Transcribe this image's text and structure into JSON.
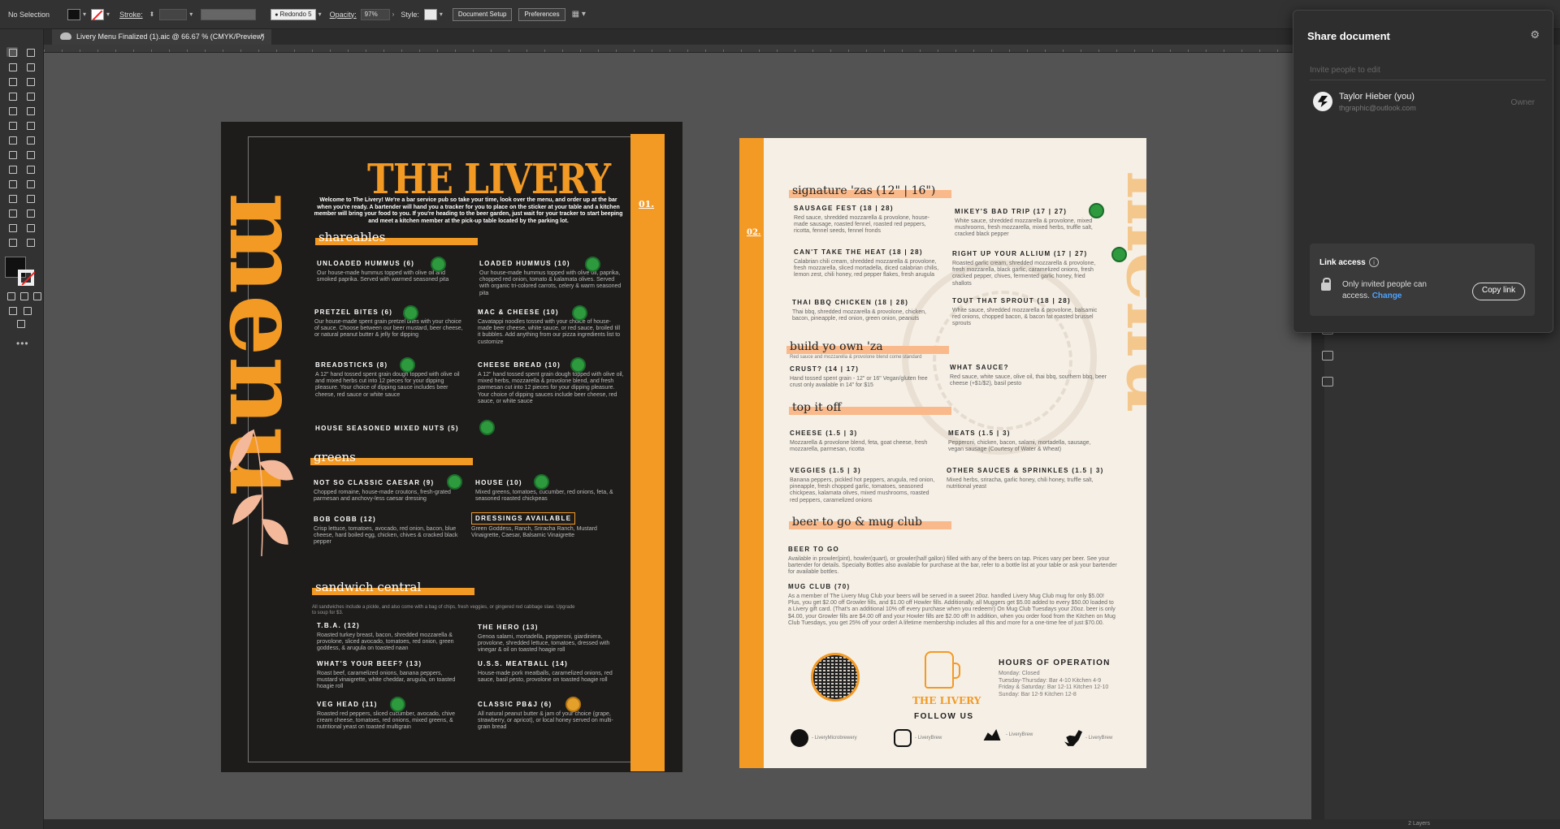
{
  "control_bar": {
    "selection": "No Selection",
    "stroke_label": "Stroke:",
    "brush": "Redondo 5",
    "opacity_label": "Opacity:",
    "opacity_value": "97%",
    "style_label": "Style:",
    "document_setup": "Document Setup",
    "preferences": "Preferences"
  },
  "tab": {
    "title": "Livery Menu Finalized (1).aic @ 66.67 % (CMYK/Preview)",
    "close": "×"
  },
  "status_bar": {
    "layers": "2 Layers"
  },
  "share": {
    "title": "Share document",
    "invite_placeholder": "Invite people to edit",
    "user_name": "Taylor Hieber (you)",
    "user_email": "thgraphic@outlook.com",
    "role": "Owner",
    "link_access_label": "Link access",
    "access_text": "Only invited people can access.",
    "change": "Change",
    "copy_link": "Copy link"
  },
  "page1": {
    "menu_word": "menu",
    "title": "THE LIVERY",
    "page_number": "01.",
    "welcome": "Welcome to The Livery! We're a bar service pub so take your time, look over the menu, and order up at the bar when you're ready. A bartender will hand you a tracker for you to place on the sticker at your table and a kitchen member will bring your food to you. If you're heading to the beer garden, just wait for your tracker to start beeping and meet a kitchen member at the pick-up table located by the parking lot.",
    "shareables": {
      "heading": "shareables",
      "items": [
        {
          "name": "UNLOADED HUMMUS (6)",
          "desc": "Our house-made hummus topped with olive oil and smoked paprika. Served with warmed seasoned pita"
        },
        {
          "name": "LOADED HUMMUS (10)",
          "desc": "Our house-made hummus topped with olive oil, paprika, chopped red onion, tomato & kalamata olives. Served with organic tri-colored carrots, celery & warm seasoned pita"
        },
        {
          "name": "PRETZEL BITES (6)",
          "desc": "Our house-made spent grain pretzel bites with your choice of sauce. Choose between our beer mustard, beer cheese, or natural peanut butter & jelly for dipping"
        },
        {
          "name": "MAC & CHEESE (10)",
          "desc": "Cavatappi noodles tossed with your choice of house-made beer cheese, white sauce, or red sauce, broiled till it bubbles. Add anything from our pizza ingredients list to customize"
        },
        {
          "name": "BREADSTICKS (8)",
          "desc": "A 12\" hand tossed spent grain dough topped with olive oil and mixed herbs cut into 12 pieces for your dipping pleasure. Your choice of dipping sauce includes beer cheese, red sauce or white sauce"
        },
        {
          "name": "CHEESE BREAD (10)",
          "desc": "A 12\" hand tossed spent grain dough topped with olive oil, mixed herbs, mozzarella & provolone blend, and fresh parmesan cut into 12 pieces for your dipping pleasure. Your choice of dipping sauces include beer cheese, red sauce, or white sauce"
        },
        {
          "name": "HOUSE SEASONED MIXED NUTS (5)",
          "desc": ""
        }
      ]
    },
    "greens": {
      "heading": "greens",
      "items": [
        {
          "name": "NOT SO CLASSIC CAESAR (9)",
          "desc": "Chopped romaine, house-made croutons, fresh-grated parmesan and anchovy-less caesar dressing"
        },
        {
          "name": "HOUSE (10)",
          "desc": "Mixed greens, tomatoes, cucumber, red onions, feta, & seasoned roasted chickpeas"
        },
        {
          "name": "BOB COBB (12)",
          "desc": "Crisp lettuce, tomatoes, avocado, red onion, bacon, blue cheese, hard boiled egg, chicken, chives & cracked black pepper"
        },
        {
          "name": "DRESSINGS AVAILABLE",
          "desc": "Green Goddess, Ranch, Sriracha Ranch, Mustard Vinaigrette, Caesar, Balsamic Vinaigrette"
        }
      ]
    },
    "sandwich": {
      "heading": "sandwich central",
      "note": "All sandwiches include a pickle, and also come with a bag of chips, fresh veggies, or gingered red cabbage slaw. Upgrade to soup for $3.",
      "items": [
        {
          "name": "T.B.A. (12)",
          "desc": "Roasted turkey breast, bacon, shredded mozzarella & provolone, sliced avocado, tomatoes, red onion, green goddess, & arugula on toasted naan"
        },
        {
          "name": "THE HERO (13)",
          "desc": "Genoa salami, mortadella, pepperoni, giardiniera, provolone, shredded lettuce, tomatoes, dressed with vinegar & oil on toasted hoagie roll"
        },
        {
          "name": "WHAT'S YOUR BEEF? (13)",
          "desc": "Roast beef, caramelized onions, banana peppers, mustard vinaigrette, white cheddar, arugula, on toasted hoagie roll"
        },
        {
          "name": "U.S.S. MEATBALL (14)",
          "desc": "House-made pork meatballs, caramelized onions, red sauce, basil pesto, provolone on toasted hoagie roll"
        },
        {
          "name": "VEG HEAD (11)",
          "desc": "Roasted red peppers, sliced cucumber, avocado, chive cream cheese, tomatoes, red onions, mixed greens, & nutritional yeast on toasted multigrain"
        },
        {
          "name": "CLASSIC PB&J (6)",
          "desc": "All natural peanut butter & jam of your choice (grape, strawberry, or apricot), or local honey served on multi-grain bread"
        }
      ]
    }
  },
  "page2": {
    "page_number": "02.",
    "menu_word": "menu",
    "zas": {
      "heading": "signature 'zas (12\" | 16\")",
      "items": [
        {
          "name": "SAUSAGE FEST (18 | 28)",
          "desc": "Red sauce, shredded mozzarella & provolone, house-made sausage, roasted fennel, roasted red peppers, ricotta, fennel seeds, fennel fronds"
        },
        {
          "name": "MIKEY'S BAD TRIP (17 | 27)",
          "desc": "White sauce, shredded mozzarella & provolone, mixed mushrooms, fresh mozzarella, mixed herbs, truffle salt, cracked black pepper"
        },
        {
          "name": "CAN'T TAKE THE HEAT (18 | 28)",
          "desc": "Calabrian chili cream, shredded mozzarella & provolone, fresh mozzarella, sliced mortadella, diced calabrian chilis, lemon zest, chili honey, red pepper flakes, fresh arugula"
        },
        {
          "name": "RIGHT UP YOUR ALLIUM (17 | 27)",
          "desc": "Roasted garlic cream, shredded mozzarella & provolone, fresh mozzarella, black garlic, caramelized onions, fresh cracked pepper, chives, fermented garlic honey, fried shallots"
        },
        {
          "name": "THAI BBQ CHICKEN (18 | 28)",
          "desc": "Thai bbq, shredded mozzarella & provolone, chicken, bacon, pineapple, red onion, green onion, peanuts"
        },
        {
          "name": "TOUT THAT SPROUT (18 | 28)",
          "desc": "White sauce, shredded mozzarella & provolone, balsamic red onions, chopped bacon, & bacon fat roasted brussel sprouts"
        }
      ]
    },
    "byo": {
      "heading": "build yo own 'za",
      "sub": "Red sauce and mozzarella & provolone blend come standard",
      "items": [
        {
          "name": "CRUST? (14 | 17)",
          "desc": "Hand tossed spent grain - 12\" or 16\" Vegan/gluten free crust only available in 14\" for $15"
        },
        {
          "name": "WHAT SAUCE?",
          "desc": "Red sauce, white sauce, olive oil, thai bbq, southern bbq, beer cheese (+$1/$2), basil pesto"
        }
      ]
    },
    "topit": {
      "heading": "top it off",
      "items": [
        {
          "name": "CHEESE (1.5 | 3)",
          "desc": "Mozzarella & provolone blend, feta, goat cheese, fresh mozzarella, parmesan, ricotta"
        },
        {
          "name": "MEATS (1.5 | 3)",
          "desc": "Pepperoni, chicken, bacon, salami, mortadella, sausage, vegan sausage (Courtesy of Water & Wheat)"
        },
        {
          "name": "VEGGIES (1.5 | 3)",
          "desc": "Banana peppers, pickled hot peppers, arugula, red onion, pineapple, fresh chopped garlic, tomatoes, seasoned chickpeas, kalamata olives, mixed mushrooms, roasted red peppers, caramelized onions"
        },
        {
          "name": "OTHER SAUCES & SPRINKLES (1.5 | 3)",
          "desc": "Mixed herbs, sriracha, garlic honey, chili honey, truffle salt, nutritional yeast"
        }
      ]
    },
    "beer": {
      "heading": "beer to go & mug club",
      "items": [
        {
          "name": "BEER TO GO",
          "desc": "Available in prowler(pint), howler(quart), or growler(half gallon) filled with any of the beers on tap. Prices vary per beer. See your bartender for details. Specialty Bottles also available for purchase at the bar, refer to a bottle list at your table or ask your bartender for available bottles."
        },
        {
          "name": "MUG CLUB (70)",
          "desc": "As a member of The Livery Mug Club your beers will be served in a sweet 20oz. handled Livery Mug Club mug for only $5.00! Plus, you get $2.00 off Growler fills, and $1.00 off Howler fills. Additionally, all Muggers get $5.00 added to every $50.00 loaded to a Livery gift card. (That's an additional 10% off every purchase when you redeem!) On Mug Club Tuesdays your 20oz. beer is only $4.00, your Growler fills are $4.00 off and your Howler fills are $2.00 off! In addition, when you order food from the Kitchen on Mug Club Tuesdays, you get 25% off your order! A lifetime membership includes all this and more for a one-time fee of just $70.00."
        }
      ]
    },
    "logo_text": "THE LIVERY",
    "follow": "FOLLOW US",
    "hours": {
      "title": "HOURS OF OPERATION",
      "lines": [
        "Monday: Closed",
        "Tuesday-Thursday: Bar 4-10 Kitchen 4-9",
        "Friday & Saturday: Bar 12-11 Kitchen 12-10",
        "Sunday: Bar 12-9 Kitchen 12-8"
      ]
    },
    "social": [
      {
        "icon": "facebook-icon",
        "handle": "- LiveryMicrobrewery"
      },
      {
        "icon": "instagram-icon",
        "handle": "- LiveryBrew"
      },
      {
        "icon": "untappd-icon",
        "handle": "- LiveryBrew"
      },
      {
        "icon": "twitter-icon",
        "handle": "- LiveryBrew"
      }
    ]
  }
}
